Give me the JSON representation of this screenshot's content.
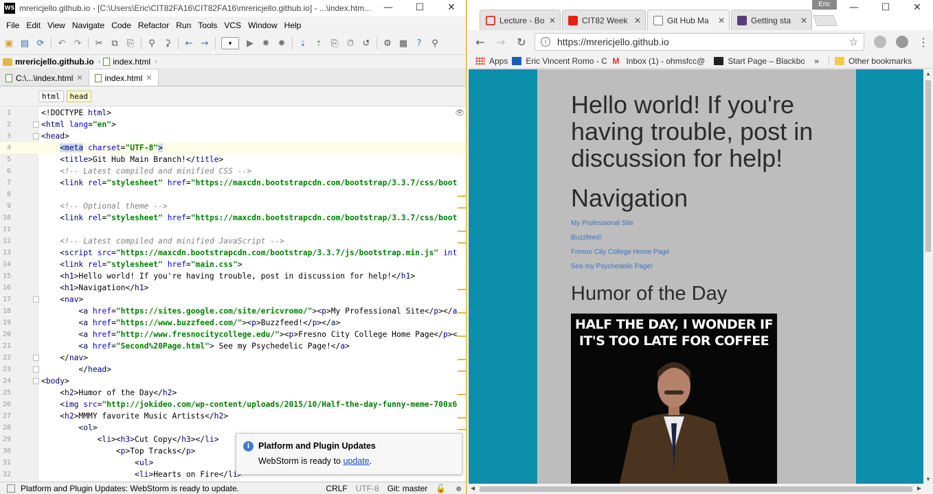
{
  "ide": {
    "window_title": "mrericjello.github.io - [C:\\Users\\Eric\\CIT82FA16\\CIT82FA16\\mrericjello.github.io] - ...\\index.htm...",
    "logo_text": "WS",
    "menu": [
      "File",
      "Edit",
      "View",
      "Navigate",
      "Code",
      "Refactor",
      "Run",
      "Tools",
      "VCS",
      "Window",
      "Help"
    ],
    "breadcrumb": {
      "project": "mrericjello.github.io",
      "file": "index.html"
    },
    "tabs": [
      {
        "label": "C:\\...\\index.html",
        "active": false
      },
      {
        "label": "index.html",
        "active": true
      }
    ],
    "tag_path": [
      "html",
      "head"
    ],
    "code_lines": [
      {
        "n": "1",
        "html": "&lt;!DOCTYPE <span class='t'>html</span>&gt;"
      },
      {
        "n": "2",
        "html": "&lt;<span class='t'>html</span> <span class='a'>lang</span>=<span class='s'>\"en\"</span>&gt;"
      },
      {
        "n": "3",
        "html": "&lt;<span class='t'>head</span>&gt;"
      },
      {
        "n": "4",
        "html": "    <span class='hl'>&lt;<span class='t'>meta</span></span> <span class='a'>charset</span>=<span class='s'>\"UTF-8\"</span><span class='hl'>&gt;</span>"
      },
      {
        "n": "5",
        "html": "    &lt;<span class='t'>title</span>&gt;Git Hub Main Branch!&lt;/<span class='t'>title</span>&gt;"
      },
      {
        "n": "6",
        "html": "    <span class='c'>&lt;!-- Latest compiled and minified CSS --&gt;</span>"
      },
      {
        "n": "7",
        "html": "    &lt;<span class='t'>link</span> <span class='a'>rel</span>=<span class='s'>\"stylesheet\"</span> <span class='a'>href</span>=<span class='s'>\"https://maxcdn.bootstrapcdn.com/bootstrap/3.3.7/css/boot</span>"
      },
      {
        "n": "8",
        "html": ""
      },
      {
        "n": "9",
        "html": "    <span class='c'>&lt;!-- Optional theme --&gt;</span>"
      },
      {
        "n": "10",
        "html": "    &lt;<span class='t'>link</span> <span class='a'>rel</span>=<span class='s'>\"stylesheet\"</span> <span class='a'>href</span>=<span class='s'>\"https://maxcdn.bootstrapcdn.com/bootstrap/3.3.7/css/boot</span>"
      },
      {
        "n": "11",
        "html": ""
      },
      {
        "n": "12",
        "html": "    <span class='c'>&lt;!-- Latest compiled and minified JavaScript --&gt;</span>"
      },
      {
        "n": "13",
        "html": "    &lt;<span class='t'>script</span> <span class='a'>src</span>=<span class='s'>\"https://maxcdn.bootstrapcdn.com/bootstrap/3.3.7/js/bootstrap.min.js\"</span> <span class='a'>int</span>"
      },
      {
        "n": "14",
        "html": "    &lt;<span class='t'>link</span> <span class='a'>rel</span>=<span class='s'>\"stylesheet\"</span> <span class='a'>href</span>=<span class='s'>\"main.css\"</span>&gt;"
      },
      {
        "n": "15",
        "html": "    &lt;<span class='t'>h1</span>&gt;Hello world! If you're having trouble, post in discussion for help!&lt;/<span class='t'>h1</span>&gt;"
      },
      {
        "n": "16",
        "html": "    &lt;<span class='t'>h1</span>&gt;Navigation&lt;/<span class='t'>h1</span>&gt;"
      },
      {
        "n": "17",
        "html": "    &lt;<span class='t'>nav</span>&gt;"
      },
      {
        "n": "18",
        "html": "        &lt;<span class='t'>a</span> <span class='a'>href</span>=<span class='s'>\"https://sites.google.com/site/ericvromo/\"</span>&gt;&lt;<span class='t'>p</span>&gt;My Professional Site&lt;/<span class='t'>p</span>&gt;&lt;/<span class='t'>a</span>"
      },
      {
        "n": "19",
        "html": "        &lt;<span class='t'>a</span> <span class='a'>href</span>=<span class='s'>\"https://www.buzzfeed.com/\"</span>&gt;&lt;<span class='t'>p</span>&gt;Buzzfeed!&lt;/<span class='t'>p</span>&gt;&lt;/<span class='t'>a</span>&gt;"
      },
      {
        "n": "20",
        "html": "        &lt;<span class='t'>a</span> <span class='a'>href</span>=<span class='s'>\"http://www.fresnocitycollege.edu/\"</span>&gt;&lt;<span class='t'>p</span>&gt;Fresno City College Home Page&lt;/<span class='t'>p</span>&gt;&lt;"
      },
      {
        "n": "21",
        "html": "        &lt;<span class='t'>a</span> <span class='a'>href</span>=<span class='s'>\"Second%20Page.html\"</span>&gt; See my Psychedelic Page!&lt;/<span class='t'>a</span>&gt;"
      },
      {
        "n": "22",
        "html": "    &lt;/<span class='t'>nav</span>&gt;"
      },
      {
        "n": "23",
        "html": "        &lt;/<span class='t'>head</span>&gt;"
      },
      {
        "n": "24",
        "html": "&lt;<span class='t'>body</span>&gt;"
      },
      {
        "n": "25",
        "html": "    &lt;<span class='t'>h2</span>&gt;Humor of the Day&lt;/<span class='t'>h2</span>&gt;"
      },
      {
        "n": "26",
        "html": "    &lt;<span class='t'>img</span> <span class='a'>src</span>=<span class='s'>\"http://jokideo.com/wp-content/uploads/2015/10/Half-the-day-funny-meme-700x6</span>"
      },
      {
        "n": "27",
        "html": "    &lt;<span class='t'>h2</span>&gt;MMMY favorite Music Artists&lt;/<span class='t'>h2</span>&gt;"
      },
      {
        "n": "28",
        "html": "        &lt;<span class='t'>ol</span>&gt;"
      },
      {
        "n": "29",
        "html": "            &lt;<span class='t'>li</span>&gt;&lt;<span class='t'>h3</span>&gt;Cut Copy&lt;/<span class='t'>h3</span>&gt;&lt;/<span class='t'>li</span>&gt;"
      },
      {
        "n": "30",
        "html": "                &lt;<span class='t'>p</span>&gt;Top Tracks&lt;/<span class='t'>p</span>&gt;"
      },
      {
        "n": "31",
        "html": "                    &lt;<span class='t'>ul</span>&gt;"
      },
      {
        "n": "32",
        "html": "                    &lt;<span class='t'>li</span>&gt;Hearts on Fire&lt;/<span class='t'>li</span>&gt;"
      }
    ],
    "notification": {
      "title": "Platform and Plugin Updates",
      "body_prefix": "WebStorm is ready to ",
      "link": "update",
      "body_suffix": "."
    },
    "status": {
      "message": "Platform and Plugin Updates: WebStorm is ready to update.",
      "line_sep": "CRLF",
      "encoding": "UTF-8",
      "vcs": "Git: master"
    }
  },
  "browser": {
    "profile": "Eric",
    "tabs": [
      {
        "label": "Lecture - Bo",
        "favicon_color": "#d9442e",
        "active": false
      },
      {
        "label": "CIT82 Week",
        "favicon_color": "#e62117",
        "active": false
      },
      {
        "label": "Git Hub Ma",
        "favicon_color": "#ffffff",
        "active": true
      },
      {
        "label": "Getting sta",
        "favicon_color": "#563d7c",
        "active": false
      }
    ],
    "url": "https://mrericjello.github.io",
    "bookmarks": [
      {
        "label": "Apps",
        "icon": "apps-grid-icon"
      },
      {
        "label": "Eric Vincent Romo - C",
        "icon": "mail-icon"
      },
      {
        "label": "Inbox (1) - ohmsfcc@",
        "icon": "gmail-icon"
      },
      {
        "label": "Start Page – Blackboa",
        "icon": "blackboard-icon"
      }
    ],
    "overflow": "»",
    "other_bookmarks": "Other bookmarks",
    "page": {
      "heading": "Hello world! If you're having trouble, post in discussion for help!",
      "nav_heading": "Navigation",
      "nav_links": [
        "My Professional Site",
        "Buzzfeed!",
        "Fresno City College Home Page",
        "See my Psychedelic Page!"
      ],
      "humor_heading": "Humor of the Day",
      "meme_caption": "HALF THE DAY, I WONDER IF IT'S TOO LATE FOR COFFEE"
    },
    "colors": {
      "page_bg": "#0b8faa",
      "content_bg": "#bdbdbd",
      "link": "#3a72c4"
    }
  }
}
